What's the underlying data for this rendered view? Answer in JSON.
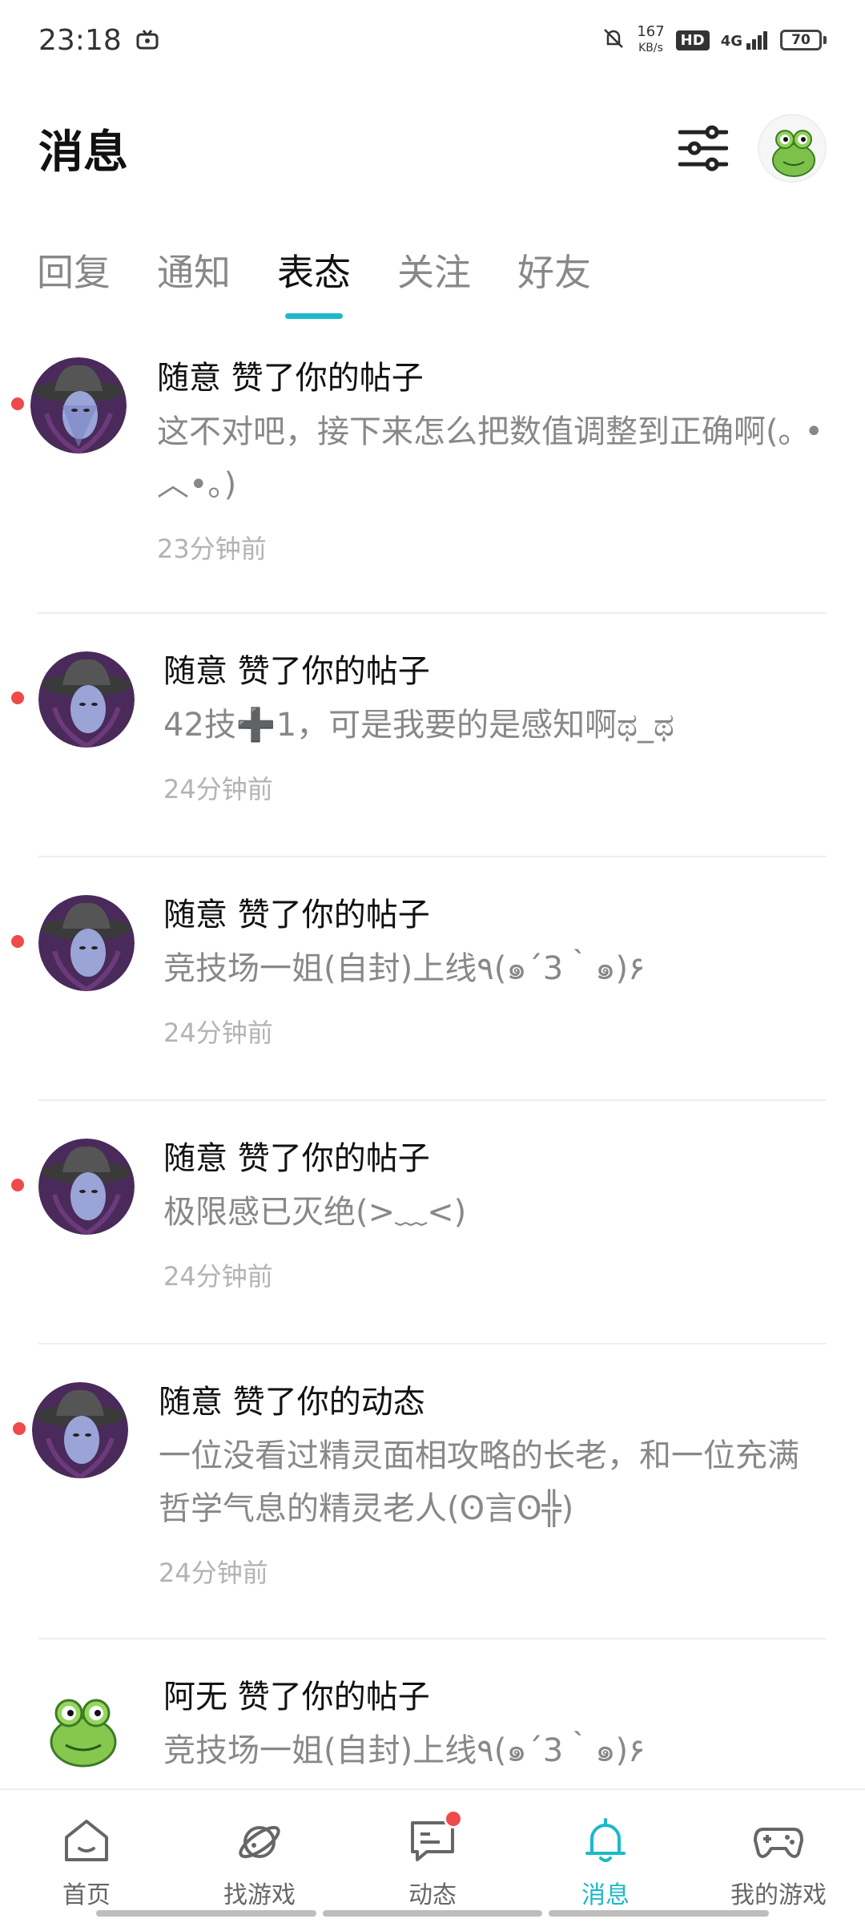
{
  "status_bar": {
    "time": "23:18",
    "net_speed_value": "167",
    "net_speed_unit": "KB/s",
    "hd": "HD",
    "network": "4G",
    "battery": "70"
  },
  "header": {
    "title": "消息"
  },
  "tabs": [
    {
      "label": "回复"
    },
    {
      "label": "通知"
    },
    {
      "label": "表态"
    },
    {
      "label": "关注"
    },
    {
      "label": "好友"
    }
  ],
  "messages": [
    {
      "title": "随意 赞了你的帖子",
      "body": "这不对吧，接下来怎么把数值调整到正确啊(｡ •︿•｡)",
      "time": "23分钟前",
      "unread": true,
      "avatar": "cowboy-hat-avatar"
    },
    {
      "title": "随意 赞了你的帖子",
      "body": "42技➕1，可是我要的是感知啊ಥ_ಥ",
      "time": "24分钟前",
      "unread": true,
      "avatar": "cowboy-hat-avatar"
    },
    {
      "title": "随意 赞了你的帖子",
      "body": "竞技场一姐(自封)上线٩(๑´3｀๑)۶",
      "time": "24分钟前",
      "unread": true,
      "avatar": "cowboy-hat-avatar"
    },
    {
      "title": "随意 赞了你的帖子",
      "body": "极限感已灭绝(>﹏<)",
      "time": "24分钟前",
      "unread": true,
      "avatar": "cowboy-hat-avatar"
    },
    {
      "title": "随意 赞了你的动态",
      "body": "一位没看过精灵面相攻略的长老，和一位充满哲学气息的精灵老人(ʘ言ʘ╬)",
      "time": "24分钟前",
      "unread": true,
      "avatar": "cowboy-hat-avatar"
    },
    {
      "title": "阿无 赞了你的帖子",
      "body": "竞技场一姐(自封)上线٩(๑´3｀๑)۶",
      "time": "",
      "unread": false,
      "avatar": "frog-avatar"
    }
  ],
  "bottom_nav": [
    {
      "label": "首页",
      "icon": "home-icon"
    },
    {
      "label": "找游戏",
      "icon": "planet-icon"
    },
    {
      "label": "动态",
      "icon": "chat-icon",
      "badge": true
    },
    {
      "label": "消息",
      "icon": "bell-icon",
      "active": true
    },
    {
      "label": "我的游戏",
      "icon": "gamepad-icon"
    }
  ],
  "colors": {
    "accent": "#1bb9c9",
    "unread_dot": "#ef4a4a",
    "muted_text": "#888888"
  }
}
